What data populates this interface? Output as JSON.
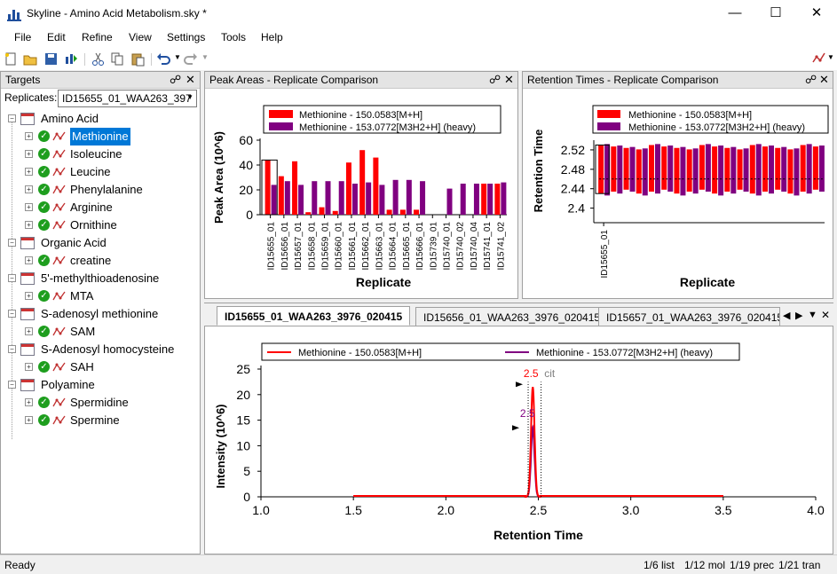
{
  "window": {
    "title": "Skyline - Amino Acid Metabolism.sky *"
  },
  "menu": [
    "File",
    "Edit",
    "Refine",
    "View",
    "Settings",
    "Tools",
    "Help"
  ],
  "targets_panel": {
    "title": "Targets",
    "replicates_label": "Replicates:",
    "replicate_value": "ID15655_01_WAA263_397",
    "groups": [
      {
        "name": "Amino Acid",
        "items": [
          "Methionine",
          "Isoleucine",
          "Leucine",
          "Phenylalanine",
          "Arginine",
          "Ornithine"
        ]
      },
      {
        "name": "Organic Acid",
        "items": [
          "creatine"
        ]
      },
      {
        "name": "5'-methylthioadenosine",
        "items": [
          "MTA"
        ]
      },
      {
        "name": "S-adenosyl methionine",
        "items": [
          "SAM"
        ]
      },
      {
        "name": "S-Adenosyl homocysteine",
        "items": [
          "SAH"
        ]
      },
      {
        "name": "Polyamine",
        "items": [
          "Spermidine",
          "Spermine"
        ]
      }
    ],
    "selected": "Methionine"
  },
  "peak_areas": {
    "title": "Peak Areas - Replicate Comparison",
    "chart_data": {
      "type": "bar",
      "xlabel": "Replicate",
      "ylabel": "Peak Area (10^6)",
      "ylim": [
        0,
        60
      ],
      "yticks": [
        0,
        20,
        40,
        60
      ],
      "categories": [
        "ID15655_01",
        "ID15656_01",
        "ID15657_01",
        "ID15658_01",
        "ID15659_01",
        "ID15660_01",
        "ID15661_01",
        "ID15662_01",
        "ID15663_01",
        "ID15664_01",
        "ID15665_01",
        "ID15666_01",
        "ID15739_01",
        "ID15740_01",
        "ID15740_02",
        "ID15740_04",
        "ID15741_01",
        "ID15741_02"
      ],
      "series": [
        {
          "name": "Methionine - 150.0583[M+H]",
          "color": "#ff0000",
          "values": [
            44,
            31,
            43,
            2,
            6,
            3,
            42,
            52,
            46,
            4,
            4,
            4,
            0,
            0,
            0,
            0,
            25,
            25
          ]
        },
        {
          "name": "Methionine - 153.0772[M3H2+H] (heavy)",
          "color": "#800080",
          "values": [
            24,
            27,
            24,
            27,
            27,
            27,
            25,
            26,
            24,
            28,
            28,
            27,
            0,
            21,
            25,
            25,
            25,
            26
          ]
        }
      ],
      "legend": "top"
    }
  },
  "retention_times": {
    "title": "Retention Times - Replicate Comparison",
    "chart_data": {
      "type": "bar",
      "xlabel": "Replicate",
      "ylabel": "Retention Time",
      "ylim": [
        2.37,
        2.54
      ],
      "yticks": [
        2.4,
        2.44,
        2.48,
        2.52
      ],
      "categories": [
        "ID15655_01"
      ],
      "series": [
        {
          "name": "Methionine - 150.0583[M+H]",
          "color": "#ff0000"
        },
        {
          "name": "Methionine - 153.0772[M3H2+H] (heavy)",
          "color": "#800080"
        }
      ],
      "ranges_low": [
        2.43,
        2.43,
        2.43,
        2.43,
        2.43,
        2.43,
        2.43,
        2.43,
        2.43,
        2.43,
        2.43,
        2.43,
        2.43,
        2.43,
        2.43,
        2.43,
        2.43,
        2.43
      ],
      "ranges_high": [
        2.53,
        2.53,
        2.53,
        2.53,
        2.53,
        2.53,
        2.53,
        2.53,
        2.53,
        2.53,
        2.53,
        2.53,
        2.53,
        2.53,
        2.53,
        2.53,
        2.53,
        2.53
      ],
      "legend": "top"
    }
  },
  "chrom_tabs": [
    "ID15655_01_WAA263_3976_020415",
    "ID15656_01_WAA263_3976_020415",
    "ID15657_01_WAA263_3976_020415"
  ],
  "chromatogram": {
    "chart_data": {
      "type": "line",
      "xlabel": "Retention Time",
      "ylabel": "Intensity (10^6)",
      "xlim": [
        1.0,
        4.0
      ],
      "ylim": [
        0,
        25
      ],
      "xticks": [
        1.0,
        1.5,
        2.0,
        2.5,
        3.0,
        3.5,
        4.0
      ],
      "yticks": [
        0,
        5,
        10,
        15,
        20,
        25
      ],
      "series": [
        {
          "name": "Methionine - 150.0583[M+H]",
          "color": "#ff0000",
          "peak_x": 2.47,
          "peak_y": 21.5,
          "range": [
            1.5,
            3.5
          ]
        },
        {
          "name": "Methionine - 153.0772[M3H2+H] (heavy)",
          "color": "#800080",
          "peak_x": 2.47,
          "peak_y": 13.5,
          "range": [
            1.5,
            3.5
          ]
        }
      ],
      "annotations": [
        {
          "text": "2.5",
          "color": "#ff0000",
          "x": 2.47,
          "y": 21.5
        },
        {
          "text": "2.5",
          "color": "#800080",
          "x": 2.47,
          "y": 13.5
        },
        {
          "text": "cit",
          "color": "#808080"
        }
      ]
    }
  },
  "status": {
    "ready": "Ready",
    "list": "1/6 list",
    "mol": "1/12 mol",
    "prec": "1/19 prec",
    "tran": "1/21 tran"
  }
}
